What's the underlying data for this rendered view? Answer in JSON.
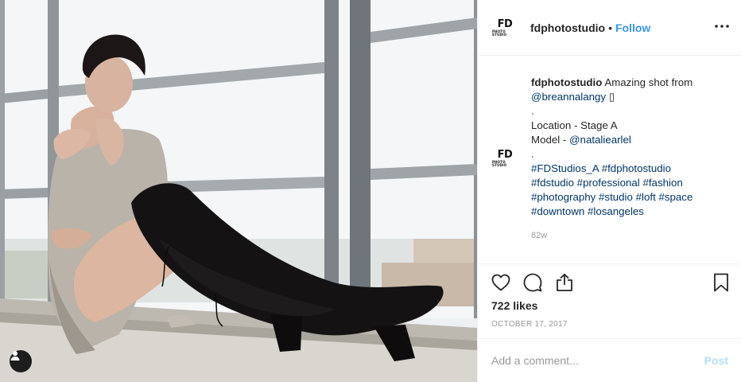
{
  "post": {
    "username": "fdphotostudio",
    "follow_label": "Follow",
    "separator": "•",
    "avatar_text_big": "FD",
    "avatar_text_small": "PHOTO STUDIO"
  },
  "caption": {
    "username": "fdphotostudio",
    "text_intro": " Amazing shot from",
    "mention_1": "@breannalangy",
    "emoji": "▯",
    "dot_1": ".",
    "location_line": "Location - Stage A",
    "model_prefix": "Model - ",
    "mention_2": "@nataliearlel",
    "dot_2": ".",
    "hashtags": [
      [
        "#FDStudios_A",
        "#fdphotostudio"
      ],
      [
        "#fdstudio",
        "#professional",
        "#fashion"
      ],
      [
        "#photography",
        "#studio",
        "#loft",
        "#space"
      ],
      [
        "#downtown",
        "#losangeles"
      ]
    ],
    "time_ago": "82w"
  },
  "stats": {
    "likes": "722 likes",
    "date": "OCTOBER 17, 2017"
  },
  "comment": {
    "placeholder": "Add a comment...",
    "post_label": "Post"
  },
  "icons": {
    "tag": "person-tag-icon",
    "more": "more-horizontal-icon",
    "like": "heart-icon",
    "comment": "comment-bubble-icon",
    "share": "share-icon",
    "save": "bookmark-icon"
  },
  "colors": {
    "accent": "#3897f0",
    "link": "#003569",
    "muted": "#999999",
    "post_disabled": "#b2dffc"
  }
}
